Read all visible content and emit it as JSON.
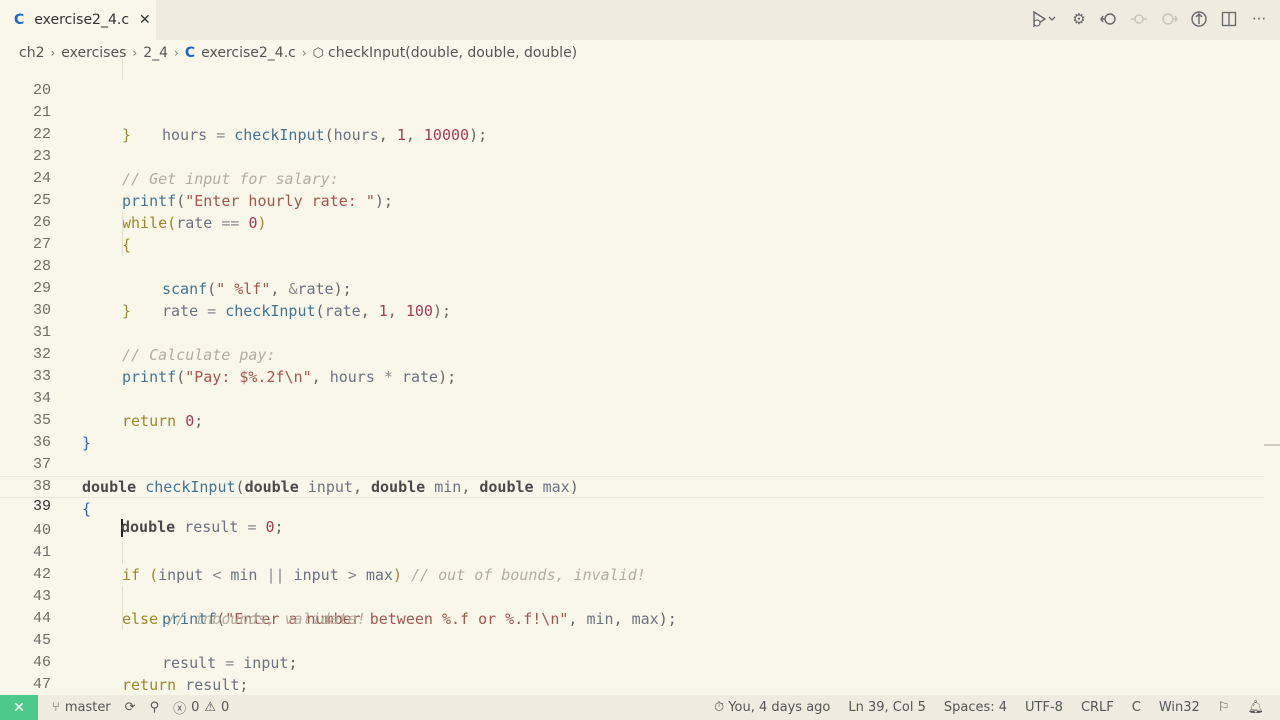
{
  "tab": {
    "lang_icon": "C",
    "name": "exercise2_4.c"
  },
  "toolbar": {
    "icons": [
      "run-debug-icon",
      "settings-gear-icon",
      "go-back-icon",
      "go-prev-icon",
      "go-next-icon",
      "copilot-icon",
      "split-editor-icon",
      "more-actions-icon"
    ]
  },
  "breadcrumb": {
    "items": [
      "ch2",
      "exercises",
      "2_4"
    ],
    "file_icon": "C",
    "file": "exercise2_4.c",
    "symbol": "checkInput(double, double, double)"
  },
  "editor": {
    "current_line": 39,
    "lines": [
      {
        "n": "20"
      },
      {
        "n": "21"
      },
      {
        "n": "22"
      },
      {
        "n": "23"
      },
      {
        "n": "24"
      },
      {
        "n": "25"
      },
      {
        "n": "26"
      },
      {
        "n": "27"
      },
      {
        "n": "28"
      },
      {
        "n": "29"
      },
      {
        "n": "30"
      },
      {
        "n": "31"
      },
      {
        "n": "32"
      },
      {
        "n": "33"
      },
      {
        "n": "34"
      },
      {
        "n": "35"
      },
      {
        "n": "36"
      },
      {
        "n": "37"
      },
      {
        "n": "38"
      },
      {
        "n": "39"
      },
      {
        "n": "40"
      },
      {
        "n": "41"
      },
      {
        "n": "42"
      },
      {
        "n": "43"
      },
      {
        "n": "44"
      },
      {
        "n": "45"
      },
      {
        "n": "46"
      },
      {
        "n": "47"
      }
    ],
    "tokens": {
      "l20": [
        "hours",
        "=",
        "checkInput",
        "(",
        "hours",
        ",",
        "1",
        ",",
        "10000",
        ");"
      ],
      "c23": "// Get input for salary:",
      "s24": "\"Enter hourly rate: \"",
      "f_printf": "printf",
      "f_while": "while",
      "f_scanf": "scanf",
      "s27": "\" %lf\"",
      "s32": "\"Pay: $%.2f\\n\"",
      "c31": "// Calculate pay:",
      "kw_return": "return",
      "kw_double": "double",
      "fn_check": "checkInput",
      "c41": "// out of bounds, invalid!",
      "s42": "\"Enter a number between %.f or %.f!\\n\"",
      "c43": "// inbounds, validate!",
      "kw_if": "if",
      "kw_else": "else"
    }
  },
  "status": {
    "branch": "master",
    "errors": "0",
    "warnings": "0",
    "blame": "You, 4 days ago",
    "position": "Ln 39, Col 5",
    "spaces": "Spaces: 4",
    "encoding": "UTF-8",
    "eol": "CRLF",
    "language": "C",
    "platform": "Win32"
  }
}
